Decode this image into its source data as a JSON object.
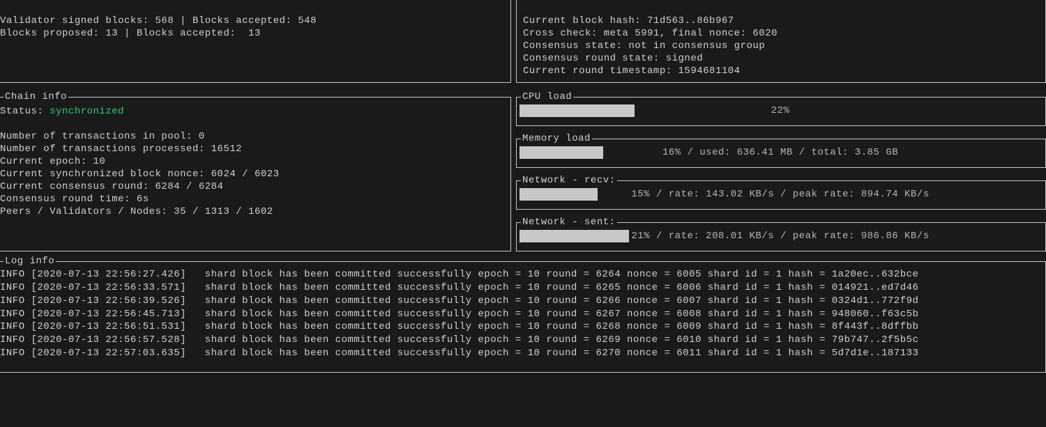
{
  "top_left": {
    "line1": "Validator signed blocks: 568 | Blocks accepted: 548",
    "line2": "Blocks proposed: 13 | Blocks accepted:  13"
  },
  "top_right": {
    "l1": "Current block hash: 71d563..86b967",
    "l2": "Cross check: meta 5991, final nonce: 6020",
    "l3": "Consensus state: not in consensus group",
    "l4": "Consensus round state: signed",
    "l5": "Current round timestamp: 1594681104"
  },
  "chain": {
    "title": "Chain info",
    "status_label": "Status: ",
    "status_value": "synchronized",
    "l1": "Number of transactions in pool: 0",
    "l2": "Number of transactions processed: 16512",
    "l3": "Current epoch: 10",
    "l4": "Current synchronized block nonce: 6024 / 6023",
    "l5": "Current consensus round: 6284 / 6284",
    "l6": "Consensus round time: 6s",
    "l7": "Peers / Validators / Nodes: 35 / 1313 / 1602"
  },
  "cpu": {
    "title": "CPU load",
    "text": "22%",
    "pct": 22
  },
  "mem": {
    "title": "Memory load",
    "text": "16% / used: 636.41 MB / total: 3.85 GB",
    "pct": 16
  },
  "net_recv": {
    "title": "Network - recv:",
    "text": "15% / rate: 143.02 KB/s / peak rate: 894.74 KB/s",
    "pct": 15
  },
  "net_sent": {
    "title": "Network - sent:",
    "text": "21% / rate: 208.01 KB/s / peak rate: 986.86 KB/s",
    "pct": 21
  },
  "log": {
    "title": "Log info",
    "lines": [
      "INFO [2020-07-13 22:56:27.426]   shard block has been committed successfully epoch = 10 round = 6264 nonce = 6005 shard id = 1 hash = 1a20ec..632bce",
      "INFO [2020-07-13 22:56:33.571]   shard block has been committed successfully epoch = 10 round = 6265 nonce = 6006 shard id = 1 hash = 014921..ed7d46",
      "INFO [2020-07-13 22:56:39.526]   shard block has been committed successfully epoch = 10 round = 6266 nonce = 6007 shard id = 1 hash = 0324d1..772f9d",
      "INFO [2020-07-13 22:56:45.713]   shard block has been committed successfully epoch = 10 round = 6267 nonce = 6008 shard id = 1 hash = 948060..f63c5b",
      "INFO [2020-07-13 22:56:51.531]   shard block has been committed successfully epoch = 10 round = 6268 nonce = 6009 shard id = 1 hash = 8f443f..8dffbb",
      "INFO [2020-07-13 22:56:57.528]   shard block has been committed successfully epoch = 10 round = 6269 nonce = 6010 shard id = 1 hash = 79b747..2f5b5c",
      "INFO [2020-07-13 22:57:03.635]   shard block has been committed successfully epoch = 10 round = 6270 nonce = 6011 shard id = 1 hash = 5d7d1e..187133"
    ]
  }
}
